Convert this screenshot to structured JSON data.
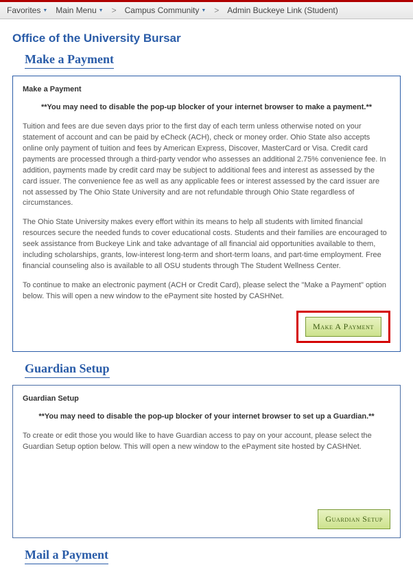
{
  "breadcrumb": {
    "favorites": "Favorites",
    "main_menu": "Main Menu",
    "campus_community": "Campus Community",
    "admin_buckeye": "Admin Buckeye Link (Student)"
  },
  "page_title": "Office of the University Bursar",
  "make_payment": {
    "heading": "Make a Payment",
    "panel_title": "Make a Payment",
    "popup_note": "**You may need to disable the pop-up blocker of your internet browser to make a payment.**",
    "para1": "Tuition and fees are due seven days prior to the first day of each term unless otherwise noted on your statement of account and can be paid by eCheck (ACH), check or money order. Ohio State also accepts online only payment of tuition and fees by American Express, Discover, MasterCard or Visa. Credit card payments are processed through a third-party vendor who assesses an additional 2.75% convenience fee. In addition, payments made by credit card may be subject to additional fees and interest as assessed by the card issuer. The convenience fee as well as any applicable fees or interest assessed by the card issuer are not assessed by The Ohio State University and are not refundable through Ohio State regardless of circumstances.",
    "para2": "The Ohio State University makes every effort within its means to help all students with limited financial resources secure the needed funds to cover educational costs. Students and their families are encouraged to seek assistance from Buckeye Link and take advantage of all financial aid opportunities available to them, including scholarships, grants, low-interest long-term and short-term loans, and part-time employment. Free financial counseling also is available to all OSU students through The Student Wellness Center.",
    "para3": "To continue to make an electronic payment (ACH or Credit Card), please select the \"Make a Payment\" option below. This will open a new window to the ePayment site hosted by CASHNet.",
    "button_label": "Make A Payment"
  },
  "guardian": {
    "heading": "Guardian Setup",
    "panel_title": "Guardian Setup",
    "popup_note": "**You may need to disable the pop-up blocker of your internet browser to set up a Guardian.**",
    "para1": "To create or edit those you would like to have Guardian access to pay on your account, please select the Guardian Setup option below. This will open a new window to the ePayment site hosted by CASHNet.",
    "button_label": "Guardian Setup"
  },
  "mail_payment": {
    "heading": "Mail a Payment"
  }
}
